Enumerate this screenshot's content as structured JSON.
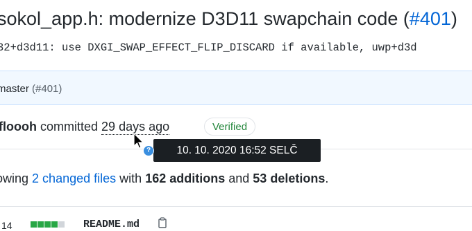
{
  "commit": {
    "title_text": "sokol_app.h: modernize D3D11 swapchain code (",
    "pr_link": "#401",
    "title_close": ")",
    "description": "32+d3d11: use DXGI_SWAP_EFFECT_FLIP_DISCARD if available, uwp+d3d"
  },
  "branch": {
    "name": "master",
    "pr": "(#401)"
  },
  "author_bar": {
    "author": "floooh",
    "committed_text": "committed",
    "relative_time": "29 days ago",
    "verified_label": "Verified"
  },
  "tooltip": {
    "text": "10. 10. 2020 16:52 SELČ",
    "icon": "question-icon"
  },
  "stats": {
    "prefix": "owing",
    "changed_files": "2 changed files",
    "with": "with",
    "additions": "162 additions",
    "and": "and",
    "deletions": "53 deletions",
    "period": "."
  },
  "file_row": {
    "count": "14",
    "name": "README.md",
    "diff_bar": [
      "add",
      "add",
      "add",
      "add",
      "neu"
    ]
  },
  "colors": {
    "link": "#0366d6",
    "verified": "#22863a",
    "tooltip_bg": "#1b1f23",
    "addition": "#28a745"
  }
}
